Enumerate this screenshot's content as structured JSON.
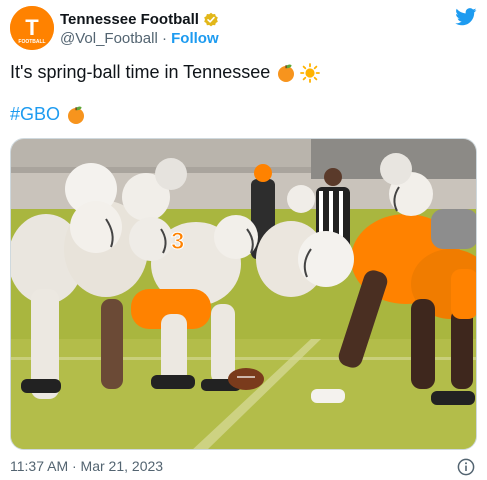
{
  "account": {
    "display_name": "Tennessee Football",
    "handle": "@Vol_Football",
    "separator": " · ",
    "follow_label": "Follow",
    "avatar_letter": "T",
    "avatar_subtext": "FOOTBALL",
    "avatar_color": "#ff8200"
  },
  "tweet": {
    "text": "It's spring-ball time in Tennessee",
    "hashtag": "#GBO",
    "emojis": [
      "orange-emoji",
      "sun-emoji"
    ]
  },
  "media": {
    "jersey_number": "3"
  },
  "footer": {
    "timestamp": "11:37 AM · Mar 21, 2023"
  },
  "colors": {
    "brand_orange": "#ff8200",
    "link_blue": "#1d9bf0",
    "muted_text": "#536471"
  }
}
